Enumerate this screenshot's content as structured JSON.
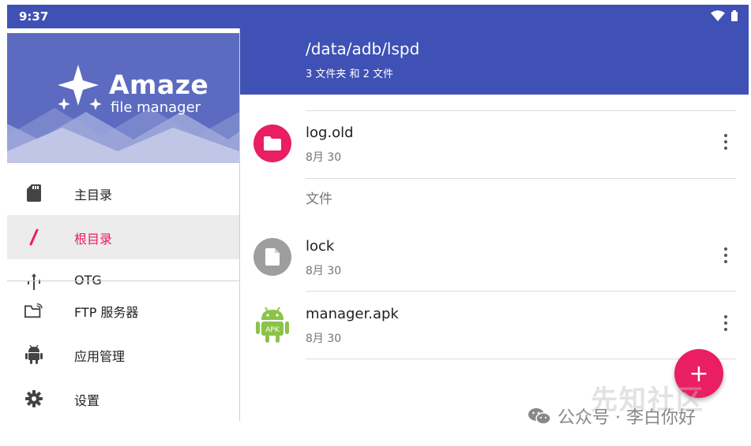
{
  "status": {
    "time": "9:37"
  },
  "appbar": {
    "path": "/data/adb/lspd",
    "summary": "3 文件夹 和 2 文件"
  },
  "drawer": {
    "brand": "Amaze",
    "brand_sub": "file manager",
    "items": [
      {
        "label": "主目录",
        "icon": "sd-card-icon"
      },
      {
        "label": "根目录",
        "icon": "slash-icon",
        "active": true
      },
      {
        "label": "OTG",
        "icon": "usb-icon"
      },
      {
        "label": "FTP 服务器",
        "icon": "ftp-folder-icon"
      },
      {
        "label": "应用管理",
        "icon": "android-icon"
      },
      {
        "label": "设置",
        "icon": "gear-icon"
      }
    ]
  },
  "list": {
    "section_files": "文件",
    "items": [
      {
        "name": "log.old",
        "date": "8月 30",
        "type": "folder",
        "color": "#e91e63"
      },
      {
        "name": "lock",
        "date": "8月 30",
        "type": "file",
        "color": "#9e9e9e"
      },
      {
        "name": "manager.apk",
        "date": "8月 30",
        "type": "apk",
        "color": "#8bc34a",
        "badge": "APK"
      }
    ]
  },
  "fab": {
    "label": "+"
  },
  "watermark": {
    "faint": "先知社区",
    "text": "公众号 · 李白你好"
  }
}
